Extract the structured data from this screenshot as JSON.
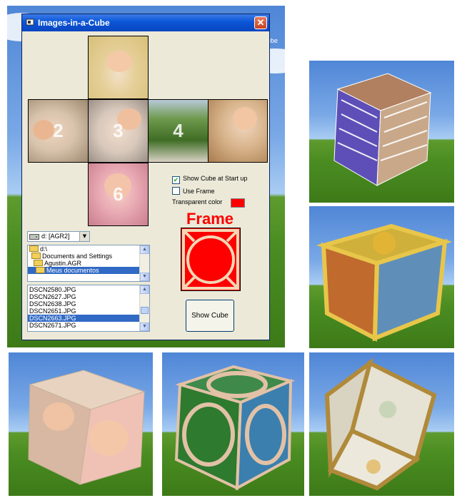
{
  "window": {
    "title": "Images-in-a-Cube",
    "close_glyph": "✕",
    "behind_text": "ube"
  },
  "faces": [
    {
      "id": "face-1",
      "number": ""
    },
    {
      "id": "face-2",
      "number": "2"
    },
    {
      "id": "face-3",
      "number": "3"
    },
    {
      "id": "face-4",
      "number": "4"
    },
    {
      "id": "face-5",
      "number": ""
    },
    {
      "id": "face-6",
      "number": "6"
    }
  ],
  "options": {
    "show_cube_at_startup": {
      "label": "Show Cube at Start up",
      "checked": true
    },
    "use_frame": {
      "label": "Use Frame",
      "checked": false
    },
    "transparent_color_label": "Transparent color",
    "transparent_color": "#ff0000"
  },
  "frame_preview": {
    "title": "Frame",
    "color": "#ff0000"
  },
  "drive": {
    "value": "d: [AGR2]"
  },
  "folders": [
    {
      "label": "d:\\",
      "selected": false
    },
    {
      "label": "Documents and Settings",
      "selected": false
    },
    {
      "label": "Agustin.AGR",
      "selected": false
    },
    {
      "label": "Meus documentos",
      "selected": true
    }
  ],
  "files": [
    {
      "label": "DSCN2580.JPG",
      "selected": false
    },
    {
      "label": "DSCN2627.JPG",
      "selected": false
    },
    {
      "label": "DSCN2638.JPG",
      "selected": false
    },
    {
      "label": "DSCN2651.JPG",
      "selected": false
    },
    {
      "label": "DSCN2663.JPG",
      "selected": true
    },
    {
      "label": "DSCN2671.JPG",
      "selected": false
    }
  ],
  "buttons": {
    "show_cube": "Show Cube"
  },
  "colors": {
    "titlebar": "#0a45c0",
    "selection": "#316ac5",
    "frame_red": "#ff0000"
  }
}
